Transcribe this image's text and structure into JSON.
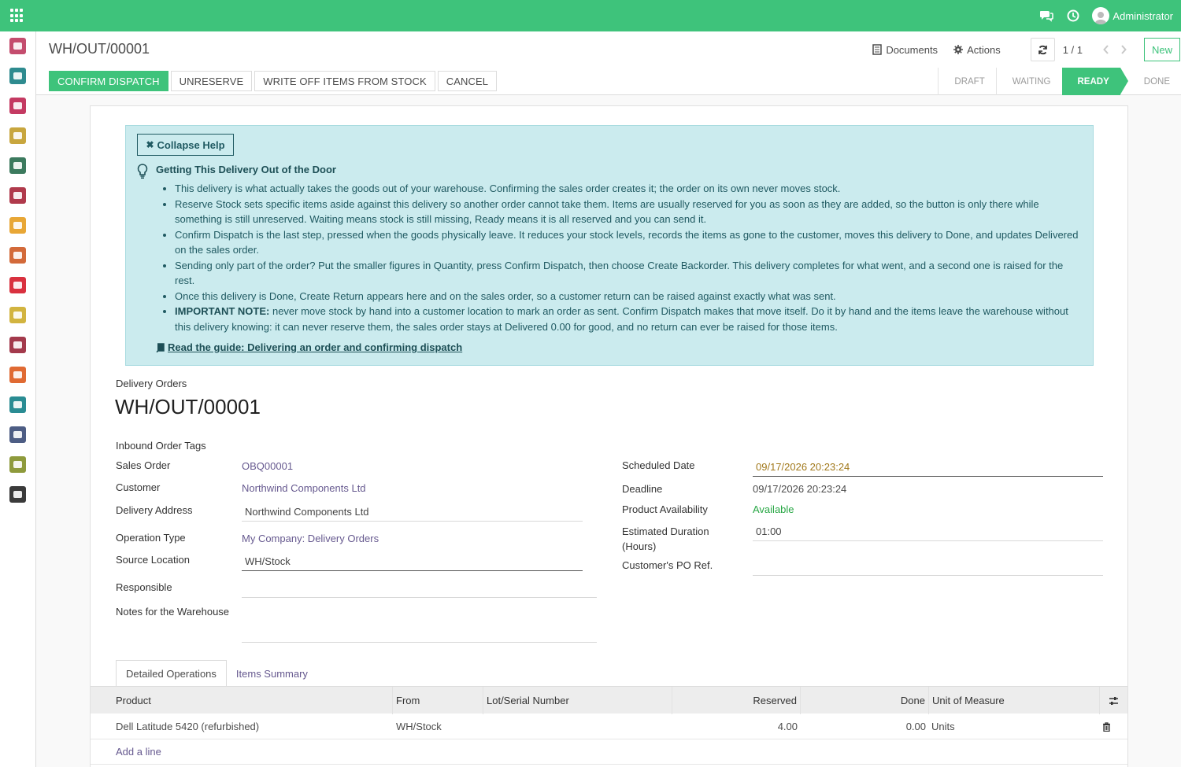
{
  "topbar": {
    "user_name": "Administrator",
    "accent": "#3ec37b"
  },
  "sidebar": {
    "items": [
      {
        "name": "dashboard-icon",
        "color": "#c44d6e"
      },
      {
        "name": "contacts-icon",
        "color": "#2e8b8f"
      },
      {
        "name": "discuss-icon",
        "color": "#c43a62"
      },
      {
        "name": "calendar-icon",
        "color": "#c8a63e"
      },
      {
        "name": "inventory-icon",
        "color": "#3c7a5e"
      },
      {
        "name": "stock-box-icon",
        "color": "#b03a4c"
      },
      {
        "name": "purchase-icon",
        "color": "#e8a736"
      },
      {
        "name": "invoicing-icon",
        "color": "#d36a3a"
      },
      {
        "name": "marketing-icon",
        "color": "#d9313f"
      },
      {
        "name": "documents-icon",
        "color": "#d2b440"
      },
      {
        "name": "delivery-truck-icon",
        "color": "#a33a4c"
      },
      {
        "name": "website-icon",
        "color": "#e06a33"
      },
      {
        "name": "employees-icon",
        "color": "#2a8c93"
      },
      {
        "name": "fleet-icon",
        "color": "#4d5d84"
      },
      {
        "name": "user-settings-icon",
        "color": "#8e9a3c"
      },
      {
        "name": "settings-icon",
        "color": "#3a3a3a"
      }
    ]
  },
  "control_panel": {
    "breadcrumb": "WH/OUT/00001",
    "documents_label": "Documents",
    "actions_label": "Actions",
    "pager": "1 / 1",
    "new_label": "New"
  },
  "action_buttons": {
    "confirm": "Confirm Dispatch",
    "unreserve": "Unreserve",
    "write_off": "Write off items from stock",
    "cancel": "Cancel"
  },
  "status_steps": [
    "Draft",
    "Waiting",
    "Ready",
    "Done"
  ],
  "help": {
    "collapse_label": "Collapse Help",
    "title": "Getting This Delivery Out of the Door",
    "bullets": [
      "This delivery is what actually takes the goods out of your warehouse. Confirming the sales order creates it; the order on its own never moves stock.",
      "Reserve Stock sets specific items aside against this delivery so another order cannot take them. Items are usually reserved for you as soon as they are added, so the button is only there while something is still unreserved. Waiting means stock is still missing, Ready means it is all reserved and you can send it.",
      "Confirm Dispatch is the last step, pressed when the goods physically leave. It reduces your stock levels, records the items as gone to the customer, moves this delivery to Done, and updates Delivered on the sales order.",
      "Sending only part of the order? Put the smaller figures in Quantity, press Confirm Dispatch, then choose Create Backorder. This delivery completes for what went, and a second one is raised for the rest.",
      "Once this delivery is Done, Create Return appears here and on the sales order, so a customer return can be raised against exactly what was sent."
    ],
    "important_label": "IMPORTANT NOTE:",
    "important_text": " never move stock by hand into a customer location to mark an order as sent. Confirm Dispatch makes that move itself. Do it by hand and the items leave the warehouse without this delivery knowing: it can never reserve them, the sales order stays at Delivered 0.00 for good, and no return can ever be raised for those items.",
    "guide_link": "Read the guide: Delivering an order and confirming dispatch"
  },
  "form": {
    "model_label": "Delivery Orders",
    "title": "WH/OUT/00001",
    "tags_label": "Inbound Order Tags",
    "left": {
      "sales_order_label": "Sales Order",
      "sales_order": "OBQ00001",
      "customer_label": "Customer",
      "customer": "Northwind Components Ltd",
      "delivery_address_label": "Delivery Address",
      "delivery_address": "Northwind Components Ltd",
      "operation_type_label": "Operation Type",
      "operation_type": "My Company: Delivery Orders",
      "source_location_label": "Source Location",
      "source_location": "WH/Stock",
      "responsible_label": "Responsible",
      "notes_label": "Notes for the Warehouse"
    },
    "right": {
      "scheduled_date_label": "Scheduled Date",
      "scheduled_date": "09/17/2026 20:23:24",
      "deadline_label": "Deadline",
      "deadline": "09/17/2026 20:23:24",
      "availability_label": "Product Availability",
      "availability": "Available",
      "duration_label_1": "Estimated Duration",
      "duration_label_2": "(Hours)",
      "duration": "01:00",
      "po_ref_label": "Customer's PO Ref."
    }
  },
  "tabs": [
    "Detailed Operations",
    "Items Summary"
  ],
  "table": {
    "columns": [
      "Product",
      "From",
      "Lot/Serial Number",
      "Reserved",
      "Done",
      "Unit of Measure"
    ],
    "rows": [
      {
        "product": "Dell Latitude 5420 (refurbished)",
        "from": "WH/Stock",
        "lot": "",
        "reserved": "4.00",
        "done": "0.00",
        "uom": "Units"
      }
    ],
    "add_line": "Add a line"
  }
}
